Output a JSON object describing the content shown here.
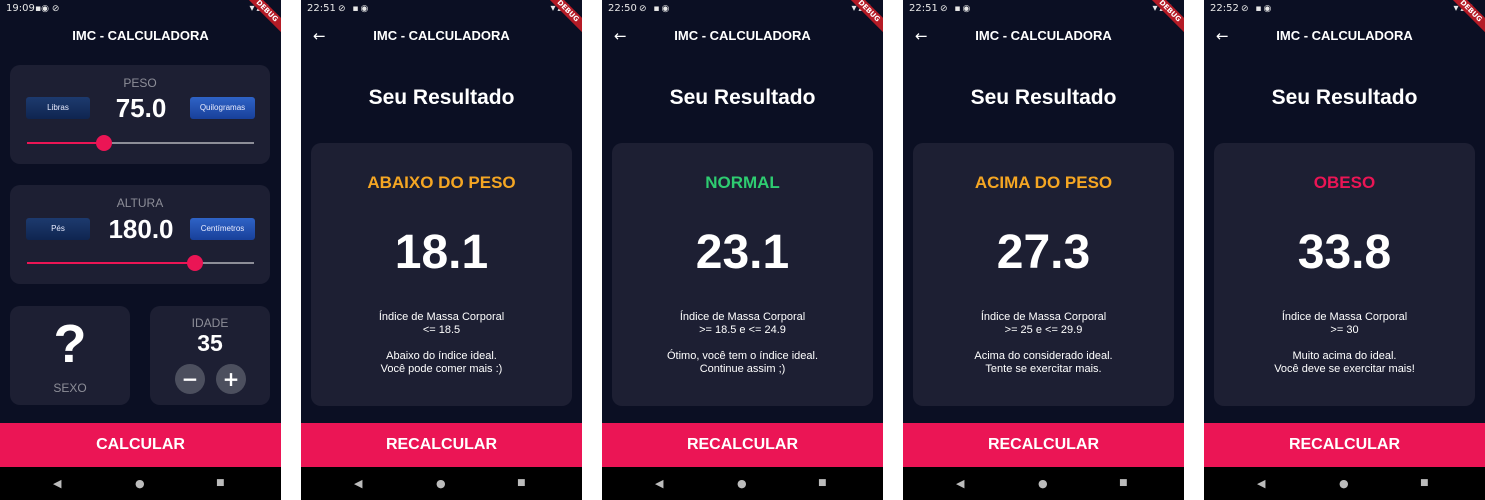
{
  "app_title": "IMC - CALCULADORA",
  "nav": {
    "back_glyph": "◀",
    "home_glyph": "●",
    "recents_glyph": "■"
  },
  "debug_label": "DEBUG",
  "colors": {
    "accent": "#eb1555",
    "background": "#0b0f23",
    "card": "#1d1f33",
    "under": "#f5a623",
    "normal": "#2ecc71",
    "over": "#f5a623",
    "obese": "#eb1555"
  },
  "input_screen": {
    "time": "19:09",
    "peso": {
      "label": "PESO",
      "value": "75.0",
      "unit_left": "Libras",
      "unit_right": "Quilogramas",
      "selected_unit": "Quilogramas",
      "slider_fraction": 0.34
    },
    "altura": {
      "label": "ALTURA",
      "value": "180.0",
      "unit_left": "Pés",
      "unit_right": "Centímetros",
      "selected_unit": "Centímetros",
      "slider_fraction": 0.74
    },
    "sexo": {
      "label": "SEXO",
      "icon": "question-mark-icon",
      "glyph": "?"
    },
    "idade": {
      "label": "IDADE",
      "value": "35",
      "minus": "−",
      "plus": "+"
    },
    "button": "CALCULAR"
  },
  "result_screens": [
    {
      "time": "22:51",
      "heading": "Seu Resultado",
      "category": "ABAIXO DO PESO",
      "category_color": "#f5a623",
      "value": "18.1",
      "index_label": "Índice de Massa Corporal",
      "range": "<= 18.5",
      "message1": "Abaixo do índice ideal.",
      "message2": "Você pode comer mais :)",
      "button": "RECALCULAR"
    },
    {
      "time": "22:50",
      "heading": "Seu Resultado",
      "category": "NORMAL",
      "category_color": "#2ecc71",
      "value": "23.1",
      "index_label": "Índice de Massa Corporal",
      "range": ">= 18.5 e <= 24.9",
      "message1": "Ótimo, você tem o índice ideal.",
      "message2": "Continue assim ;)",
      "button": "RECALCULAR"
    },
    {
      "time": "22:51",
      "heading": "Seu Resultado",
      "category": "ACIMA DO PESO",
      "category_color": "#f5a623",
      "value": "27.3",
      "index_label": "Índice de Massa Corporal",
      "range": ">= 25 e <= 29.9",
      "message1": "Acima do considerado ideal.",
      "message2": "Tente se exercitar mais.",
      "button": "RECALCULAR"
    },
    {
      "time": "22:52",
      "heading": "Seu Resultado",
      "category": "OBESO",
      "category_color": "#eb1555",
      "value": "33.8",
      "index_label": "Índice de Massa Corporal",
      "range": ">= 30",
      "message1": "Muito acima do ideal.",
      "message2": "Você deve se exercitar mais!",
      "button": "RECALCULAR"
    }
  ]
}
